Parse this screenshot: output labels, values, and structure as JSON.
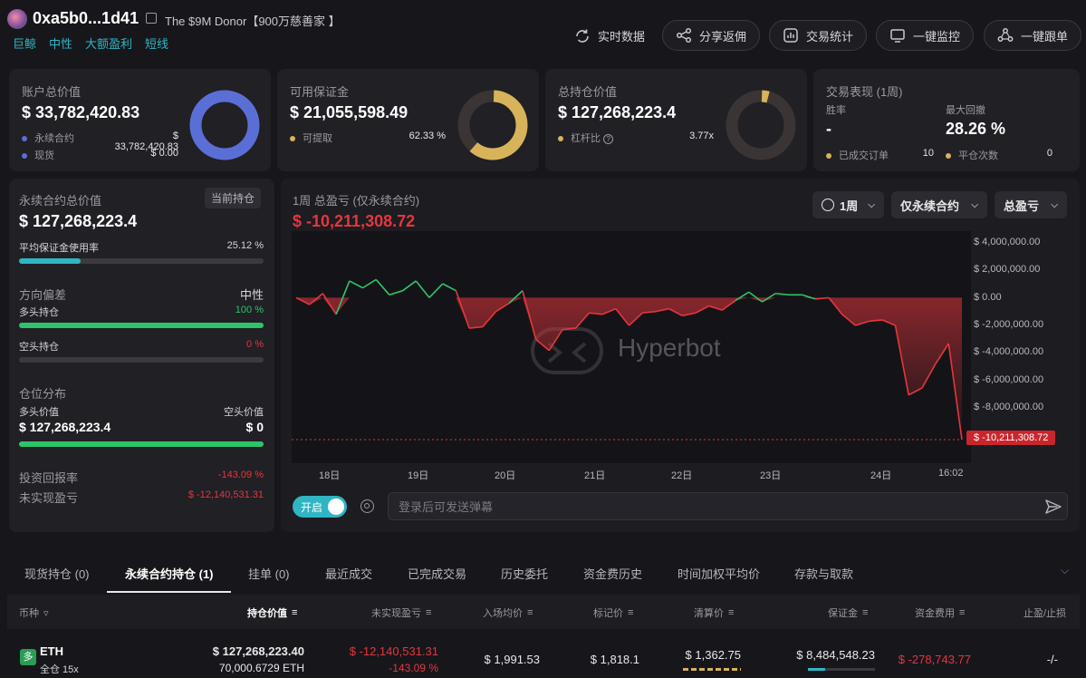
{
  "header": {
    "address": "0xa5b0...1d41",
    "nickname": "The $9M Donor【900万慈善家 】",
    "tags": [
      "巨鲸",
      "中性",
      "大额盈利",
      "短线"
    ],
    "buttons": [
      "实时数据",
      "分享返佣",
      "交易统计",
      "一键监控",
      "一键跟单"
    ]
  },
  "cards": {
    "account": {
      "title": "账户总价值",
      "value": "$ 33,782,420.83",
      "rows": [
        {
          "label": "永续合约",
          "value": "$ 33,782,420.83"
        },
        {
          "label": "现货",
          "value": "$ 0.00"
        }
      ],
      "donut_fraction": 1.0
    },
    "margin": {
      "title": "可用保证金",
      "value": "$ 21,055,598.49",
      "rows": [
        {
          "label": "可提取",
          "value": "62.33 %"
        }
      ],
      "donut_fraction": 0.6233
    },
    "position": {
      "title": "总持仓价值",
      "value": "$ 127,268,223.4",
      "rows": [
        {
          "label": "杠杆比",
          "value": "3.77x"
        }
      ],
      "donut_fraction": 0.05
    },
    "performance": {
      "title": "交易表现 (1周)",
      "winrate_label": "胜率",
      "winrate": "-",
      "drawdown_label": "最大回撤",
      "drawdown": "28.26 %",
      "rows": [
        {
          "label": "已成交订单",
          "value": "10"
        },
        {
          "label": "平仓次数",
          "value": "0"
        }
      ]
    }
  },
  "perp": {
    "title": "永续合约总价值",
    "badge": "当前持仓",
    "value": "$ 127,268,223.4",
    "margin_usage_label": "平均保证金使用率",
    "margin_usage": "25.12 %",
    "margin_usage_fraction": 0.2512,
    "bias_label": "方向偏差",
    "bias": "中性",
    "long_label": "多头持仓",
    "long_pct": "100 %",
    "long_fraction": 1.0,
    "short_label": "空头持仓",
    "short_pct": "0 %",
    "short_fraction": 0.0,
    "dist_label": "仓位分布",
    "long_value_label": "多头价值",
    "short_value_label": "空头价值",
    "long_value": "$ 127,268,223.4",
    "short_value": "$ 0",
    "roi_label": "投资回报率",
    "roi": "-143.09 %",
    "upnl_label": "未实现盈亏",
    "upnl": "$ -12,140,531.31"
  },
  "chart_panel": {
    "title": "1周 总盈亏 (仅永续合约)",
    "total": "$ -10,211,308.72",
    "selects": [
      "1周",
      "仅永续合约",
      "总盈亏"
    ],
    "watermark": "Hyperbot",
    "toggle_label": "开启",
    "input_placeholder": "登录后可发送弹幕"
  },
  "chart_data": {
    "type": "line",
    "title": "1周 总盈亏 (仅永续合约)",
    "ylim": [
      -10211308.72,
      4000000
    ],
    "y_ticks": [
      "$ 4,000,000.00",
      "$ 2,000,000.00",
      "$ 0.00",
      "$ -2,000,000.00",
      "$ -4,000,000.00",
      "$ -6,000,000.00",
      "$ -8,000,000.00"
    ],
    "y_tick_values": [
      4000000,
      2000000,
      0,
      -2000000,
      -4000000,
      -6000000,
      -8000000
    ],
    "x_ticks": [
      "18日",
      "19日",
      "20日",
      "21日",
      "22日",
      "23日",
      "24日",
      "16:02"
    ],
    "last_label": "$ -10,211,308.72",
    "x": [
      0,
      2,
      4,
      6,
      8,
      10,
      12,
      14,
      16,
      18,
      20,
      22,
      24,
      26,
      28,
      30,
      32,
      34,
      36,
      38,
      40,
      42,
      44,
      46,
      48,
      50,
      52,
      54,
      56,
      58,
      60,
      62,
      64,
      66,
      68,
      70,
      72,
      74,
      76,
      78,
      80,
      82,
      84,
      86,
      88,
      90,
      92,
      94,
      96,
      98,
      100
    ],
    "values": [
      0,
      -500000,
      300000,
      -1200000,
      1200000,
      700000,
      1300000,
      200000,
      500000,
      1200000,
      0,
      1000000,
      500000,
      -2200000,
      -2100000,
      -1000000,
      -400000,
      500000,
      -3000000,
      -3800000,
      -2300000,
      -2200000,
      -1100000,
      -1200000,
      -800000,
      -2000000,
      -1100000,
      -1000000,
      -800000,
      -1300000,
      -1100000,
      -600000,
      -900000,
      -200000,
      400000,
      -300000,
      300000,
      200000,
      200000,
      -100000,
      0,
      -1200000,
      -2000000,
      -1700000,
      -1600000,
      -2000000,
      -7000000,
      -6500000,
      -4800000,
      -3300000,
      -10211308.72
    ]
  },
  "bottom_tabs": [
    "现货持仓 (0)",
    "永续合约持仓 (1)",
    "挂单 (0)",
    "最近成交",
    "已完成交易",
    "历史委托",
    "资金费历史",
    "时间加权平均价",
    "存款与取款"
  ],
  "table": {
    "headers": [
      "币种",
      "持仓价值",
      "未实现盈亏",
      "入场均价",
      "标记价",
      "清算价",
      "保证金",
      "资金费用",
      "止盈/止损"
    ],
    "row": {
      "side": "多",
      "coin": "ETH",
      "mode": "全仓 15x",
      "value": "$ 127,268,223.40",
      "size": "70,000.6729 ETH",
      "upnl": "$ -12,140,531.31",
      "upnl_pct": "-143.09 %",
      "entry": "$ 1,991.53",
      "mark": "$ 1,818.1",
      "liq": "$ 1,362.75",
      "margin": "$ 8,484,548.23",
      "funding": "$ -278,743.77",
      "tpsl": "-/-"
    }
  },
  "colors": {
    "accent": "#2fb5c4",
    "blue": "#5a6fd6",
    "gold": "#d7b35a",
    "red": "#e5363d",
    "green": "#2fc46a"
  }
}
